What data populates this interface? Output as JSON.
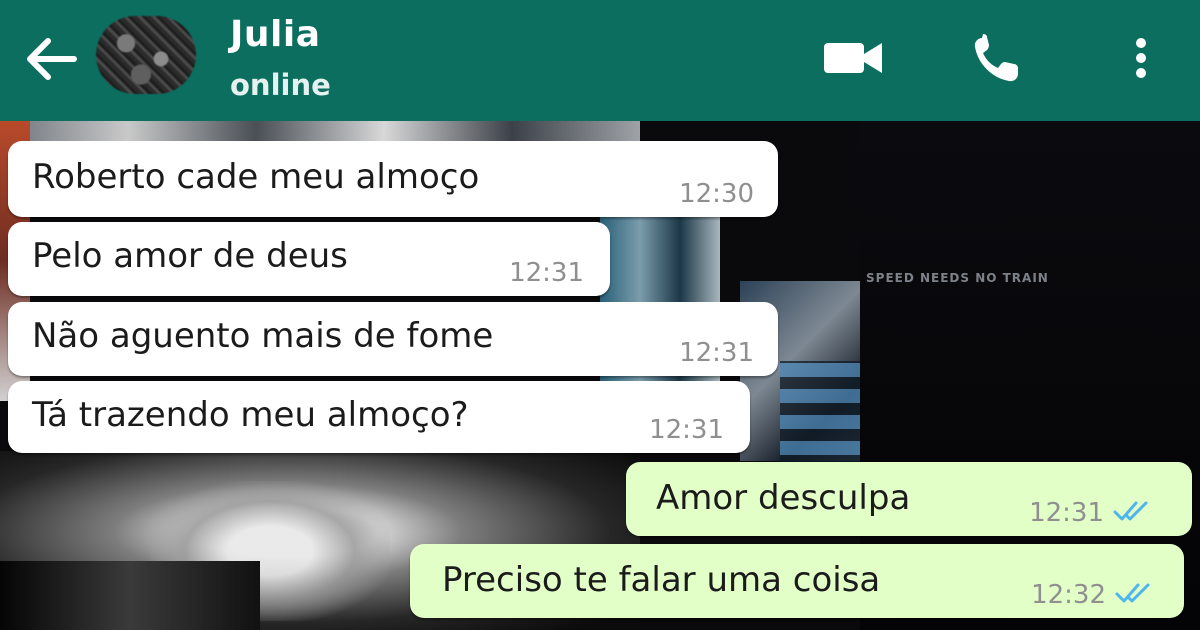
{
  "header": {
    "contact_name": "Julia",
    "status": "online",
    "icons": {
      "back": "arrow-left-icon",
      "video": "video-camera-icon",
      "call": "phone-icon",
      "menu": "vertical-dots-icon"
    }
  },
  "colors": {
    "header_bg": "#0b6e5f",
    "incoming_bubble": "#ffffff",
    "outgoing_bubble": "#e2ffc8",
    "read_ticks": "#4fb6ec"
  },
  "wallpaper": {
    "caption": "SPEED NEEDS NO TRAIN"
  },
  "messages": [
    {
      "direction": "incoming",
      "text": "Roberto cade meu almoço",
      "time": "12:30"
    },
    {
      "direction": "incoming",
      "text": "Pelo amor de deus",
      "time": "12:31"
    },
    {
      "direction": "incoming",
      "text": "Não aguento mais de fome",
      "time": "12:31"
    },
    {
      "direction": "incoming",
      "text": "Tá trazendo meu almoço?",
      "time": "12:31"
    },
    {
      "direction": "outgoing",
      "text": "Amor desculpa",
      "time": "12:31",
      "status": "read"
    },
    {
      "direction": "outgoing",
      "text": "Preciso te falar uma coisa",
      "time": "12:32",
      "status": "read"
    }
  ]
}
